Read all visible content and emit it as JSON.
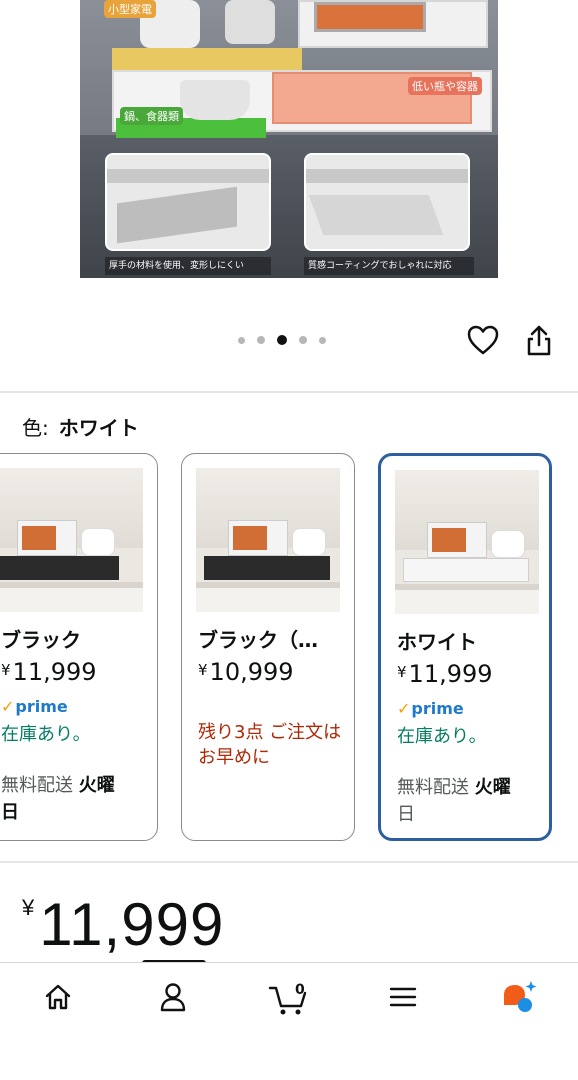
{
  "hero_image": {
    "labels": [
      "小型家電",
      "鍋、食器類",
      "低い瓶や容器"
    ],
    "captions": [
      "厚手の材料を使用、変形しにくい",
      "質感コーティングでおしゃれに対応"
    ]
  },
  "carousel": {
    "total": 5,
    "active_index": 2
  },
  "color_selector": {
    "label": "色:",
    "selected": "ホワイト"
  },
  "variants": [
    {
      "name": "ブラック",
      "yen": "¥",
      "price": "11,999",
      "prime": "prime",
      "stock": "在庫あり。",
      "ship_prefix": "無料配送 ",
      "ship_day": "火曜",
      "ship_suffix": "日",
      "selected": false
    },
    {
      "name": "ブラック（…",
      "yen": "¥",
      "price": "10,999",
      "low_stock": "残り3点 ご注文はお早めに",
      "selected": false
    },
    {
      "name": "ホワイト",
      "yen": "¥",
      "price": "11,999",
      "prime": "prime",
      "stock": "在庫あり。",
      "ship_prefix": "無料配送 ",
      "ship_day": "火曜",
      "ship_suffix": "日",
      "selected": true
    }
  ],
  "price": {
    "yen": "¥",
    "value": "11,999"
  },
  "bottom_nav": {
    "items": [
      "home-icon",
      "account-icon",
      "cart-icon",
      "menu-icon",
      "ai-assistant-icon"
    ],
    "cart_count": "0"
  },
  "colors": {
    "selected_border": "#2d5fa0",
    "in_stock": "#067d62",
    "low_stock": "#b12704",
    "prime": "#1f7ac9",
    "prime_check": "#f1a008"
  }
}
